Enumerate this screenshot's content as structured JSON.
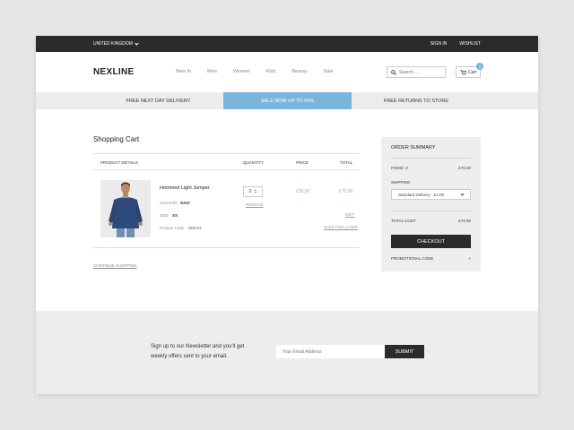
{
  "topbar": {
    "region": "UNITED KINGDOM",
    "signin": "SIGN IN",
    "wishlist": "WISHLIST"
  },
  "header": {
    "logo": "NEXLINE",
    "nav": [
      "New In",
      "Men",
      "Women",
      "Kids",
      "Beauty",
      "Sale"
    ],
    "search_placeholder": "Search...",
    "cart_label": "Cart",
    "cart_count": "1"
  },
  "promo": {
    "left": "FREE NEXT DAY DELIVERY",
    "center": "SALE NOW UP TO 50%",
    "right": "FREE RETURNS TO STORE"
  },
  "cart": {
    "title": "Shopping Cart",
    "columns": {
      "details": "PRODUCT DETAILS",
      "quantity": "QUANTITY",
      "price": "PRICE",
      "total": "TOTAL"
    },
    "item": {
      "name": "Hommed Light Jumper",
      "colour_label": "COLOUR",
      "colour": "NAVI",
      "size_label": "SIZE",
      "size": "XS",
      "code_label": "Product Code",
      "code": "185721",
      "quantity": "2",
      "price": "£35.00",
      "total": "£70.00",
      "remove": "REMOVE",
      "edit": "EDIT",
      "save_later": "SAVE FOR LATER"
    },
    "continue": "CONTINUE SHOPPING"
  },
  "summary": {
    "title": "ORDER SUMMARY",
    "items_label": "ITEMS",
    "items_count": "2",
    "items_total": "£70.00",
    "shipping_label": "SHIPPING",
    "shipping_option": "Standard Delivery - £4.00",
    "total_label": "TOTAL COST",
    "total_value": "£74.00",
    "checkout": "CHECKOUT",
    "promo_label": "PROMOTIONAL CODE",
    "promo_icon": "+"
  },
  "newsletter": {
    "text": "Sign up to our Newsletter and you'll get weekly offers sent to your email.",
    "placeholder": "Your Email Address",
    "submit": "SUBMIT"
  },
  "colors": {
    "accent": "#7bb5da",
    "dark": "#2b2b2b",
    "light_bg": "#ededed"
  }
}
